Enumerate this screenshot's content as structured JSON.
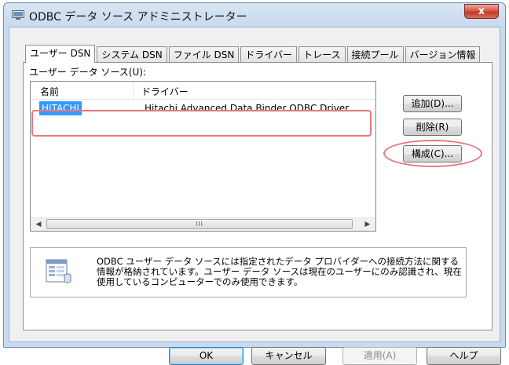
{
  "window": {
    "title": "ODBC データ ソース アドミニストレーター",
    "close_label": "x"
  },
  "tabs": [
    {
      "label": "ユーザー DSN",
      "active": true
    },
    {
      "label": "システム DSN",
      "active": false
    },
    {
      "label": "ファイル DSN",
      "active": false
    },
    {
      "label": "ドライバー",
      "active": false
    },
    {
      "label": "トレース",
      "active": false
    },
    {
      "label": "接続プール",
      "active": false
    },
    {
      "label": "バージョン情報",
      "active": false
    }
  ],
  "section_label": "ユーザー データ ソース(U):",
  "list": {
    "columns": [
      "名前",
      "ドライバー"
    ],
    "rows": [
      {
        "name": "HITACHI",
        "driver": "Hitachi Advanced Data Binder ODBC Driver",
        "selected": true
      }
    ],
    "scroll_thumb_grip": "III"
  },
  "buttons": {
    "add": "追加(D)...",
    "delete": "削除(R)",
    "configure": "構成(C)..."
  },
  "info_text": "ODBC ユーザー データ ソースには指定されたデータ プロバイダーへの接続方法に関する情報が格納されています。ユーザー データ ソースは現在のユーザーにのみ認識され、現在使用しているコンピューターでのみ使用できます。",
  "footer": {
    "ok": "OK",
    "cancel": "キャンセル",
    "apply": "適用(A)",
    "help": "ヘルプ"
  },
  "colors": {
    "selection": "#3399ff",
    "annotation": "#e8777d",
    "close_button": "#c03a25"
  }
}
